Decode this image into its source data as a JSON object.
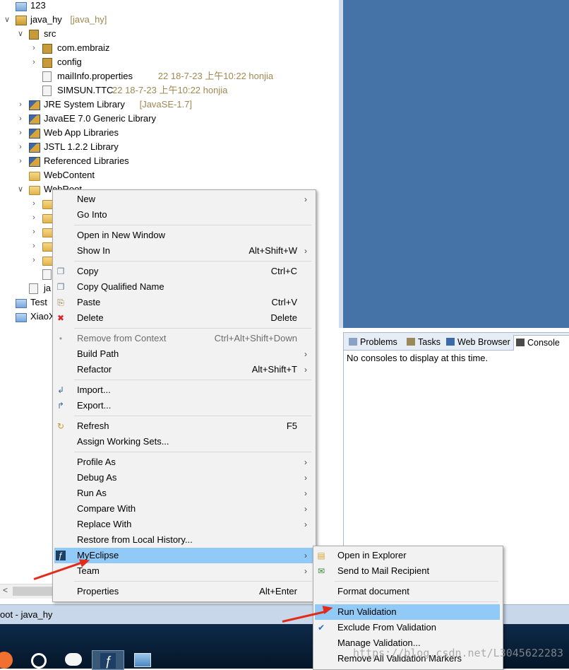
{
  "tree": [
    {
      "label": "123",
      "deco": "",
      "icon": "bfolder",
      "depth": 0,
      "arrow": ""
    },
    {
      "label": "java_hy",
      "deco": "[java_hy]",
      "icon": "proj",
      "depth": 0,
      "arrow": "down"
    },
    {
      "label": "src",
      "deco": "",
      "icon": "pkg",
      "depth": 1,
      "arrow": "down"
    },
    {
      "label": "com.embraiz",
      "deco": "",
      "icon": "pkg",
      "depth": 2,
      "arrow": "right"
    },
    {
      "label": "config",
      "deco": "",
      "icon": "pkg",
      "depth": 2,
      "arrow": "right"
    },
    {
      "label": "mailInfo.properties",
      "deco": "22  18-7-23 上午10:22  honjia",
      "icon": "file",
      "depth": 2,
      "arrow": ""
    },
    {
      "label": "SIMSUN.TTC",
      "deco": "22  18-7-23 上午10:22  honjia",
      "icon": "file",
      "depth": 2,
      "arrow": ""
    },
    {
      "label": "JRE System Library",
      "deco": "[JavaSE-1.7]",
      "icon": "lib",
      "depth": 1,
      "arrow": "right"
    },
    {
      "label": "JavaEE 7.0 Generic Library",
      "deco": "",
      "icon": "lib",
      "depth": 1,
      "arrow": "right"
    },
    {
      "label": "Web App Libraries",
      "deco": "",
      "icon": "lib",
      "depth": 1,
      "arrow": "right"
    },
    {
      "label": "JSTL 1.2.2 Library",
      "deco": "",
      "icon": "lib",
      "depth": 1,
      "arrow": "right"
    },
    {
      "label": "Referenced Libraries",
      "deco": "",
      "icon": "lib",
      "depth": 1,
      "arrow": "right"
    },
    {
      "label": "WebContent",
      "deco": "",
      "icon": "folder",
      "depth": 1,
      "arrow": ""
    },
    {
      "label": "WebRoot",
      "deco": "",
      "icon": "folder",
      "depth": 1,
      "arrow": "down"
    },
    {
      "label": "",
      "deco": "",
      "icon": "folder",
      "depth": 2,
      "arrow": "right"
    },
    {
      "label": "",
      "deco": "",
      "icon": "folder",
      "depth": 2,
      "arrow": "right"
    },
    {
      "label": "",
      "deco": "",
      "icon": "folder",
      "depth": 2,
      "arrow": "right"
    },
    {
      "label": "",
      "deco": "",
      "icon": "folder",
      "depth": 2,
      "arrow": "right"
    },
    {
      "label": "",
      "deco": "",
      "icon": "folder",
      "depth": 2,
      "arrow": "right"
    },
    {
      "label": "",
      "deco": "",
      "icon": "file",
      "depth": 2,
      "arrow": ""
    },
    {
      "label": "ja",
      "deco": "",
      "icon": "file",
      "depth": 1,
      "arrow": ""
    },
    {
      "label": "Test",
      "deco": "",
      "icon": "bfolder",
      "depth": 0,
      "arrow": ""
    },
    {
      "label": "XiaoX",
      "deco": "",
      "icon": "bfolder",
      "depth": 0,
      "arrow": ""
    }
  ],
  "status_text": "oot - java_hy",
  "views": {
    "tabs": [
      {
        "label": "Problems",
        "active": false
      },
      {
        "label": "Tasks",
        "active": false
      },
      {
        "label": "Web Browser",
        "active": false
      },
      {
        "label": "Console",
        "active": true
      }
    ],
    "console_message": "No consoles to display at this time."
  },
  "context_menu": [
    {
      "label": "New",
      "shortcut": "",
      "submenu": true,
      "icon": ""
    },
    {
      "label": "Go Into",
      "shortcut": "",
      "submenu": false,
      "icon": ""
    },
    {
      "sep": true
    },
    {
      "label": "Open in New Window",
      "shortcut": "",
      "submenu": false,
      "icon": ""
    },
    {
      "label": "Show In",
      "shortcut": "Alt+Shift+W",
      "submenu": true,
      "icon": ""
    },
    {
      "sep": true
    },
    {
      "label": "Copy",
      "shortcut": "Ctrl+C",
      "submenu": false,
      "icon": "copy-icon"
    },
    {
      "label": "Copy Qualified Name",
      "shortcut": "",
      "submenu": false,
      "icon": "copy-icon"
    },
    {
      "label": "Paste",
      "shortcut": "Ctrl+V",
      "submenu": false,
      "icon": "paste-icon"
    },
    {
      "label": "Delete",
      "shortcut": "Delete",
      "submenu": false,
      "icon": "delete-icon"
    },
    {
      "sep": true
    },
    {
      "label": "Remove from Context",
      "shortcut": "Ctrl+Alt+Shift+Down",
      "submenu": false,
      "icon": "remove-context-icon",
      "disabled": true
    },
    {
      "label": "Build Path",
      "shortcut": "",
      "submenu": true,
      "icon": ""
    },
    {
      "label": "Refactor",
      "shortcut": "Alt+Shift+T",
      "submenu": true,
      "icon": ""
    },
    {
      "sep": true
    },
    {
      "label": "Import...",
      "shortcut": "",
      "submenu": false,
      "icon": "import-icon"
    },
    {
      "label": "Export...",
      "shortcut": "",
      "submenu": false,
      "icon": "export-icon"
    },
    {
      "sep": true
    },
    {
      "label": "Refresh",
      "shortcut": "F5",
      "submenu": false,
      "icon": "refresh-icon"
    },
    {
      "label": "Assign Working Sets...",
      "shortcut": "",
      "submenu": false,
      "icon": ""
    },
    {
      "sep": true
    },
    {
      "label": "Profile As",
      "shortcut": "",
      "submenu": true,
      "icon": ""
    },
    {
      "label": "Debug As",
      "shortcut": "",
      "submenu": true,
      "icon": ""
    },
    {
      "label": "Run As",
      "shortcut": "",
      "submenu": true,
      "icon": ""
    },
    {
      "label": "Compare With",
      "shortcut": "",
      "submenu": true,
      "icon": ""
    },
    {
      "label": "Replace With",
      "shortcut": "",
      "submenu": true,
      "icon": ""
    },
    {
      "label": "Restore from Local History...",
      "shortcut": "",
      "submenu": false,
      "icon": ""
    },
    {
      "label": "MyEclipse",
      "shortcut": "",
      "submenu": true,
      "icon": "myeclipse-icon",
      "highlighted": true
    },
    {
      "label": "Team",
      "shortcut": "",
      "submenu": true,
      "icon": ""
    },
    {
      "sep": true
    },
    {
      "label": "Properties",
      "shortcut": "Alt+Enter",
      "submenu": false,
      "icon": ""
    }
  ],
  "submenu": [
    {
      "label": "Open in Explorer",
      "icon": "open-folder-icon"
    },
    {
      "label": "Send to Mail Recipient",
      "icon": "mail-icon"
    },
    {
      "sep": true
    },
    {
      "label": "Format document",
      "icon": ""
    },
    {
      "sep": true
    },
    {
      "label": "Run Validation",
      "icon": "",
      "highlighted": true
    },
    {
      "label": "Exclude From Validation",
      "icon": "checkmark-icon"
    },
    {
      "label": "Manage Validation...",
      "icon": ""
    },
    {
      "label": "Remove All Validation Markers",
      "icon": ""
    }
  ],
  "watermark": "https://blog.csdn.net/L3045622283",
  "colors": {
    "menu_highlight": "#91c9f7",
    "editor_bg": "#4673a7",
    "arrow": "#e32b1a"
  }
}
